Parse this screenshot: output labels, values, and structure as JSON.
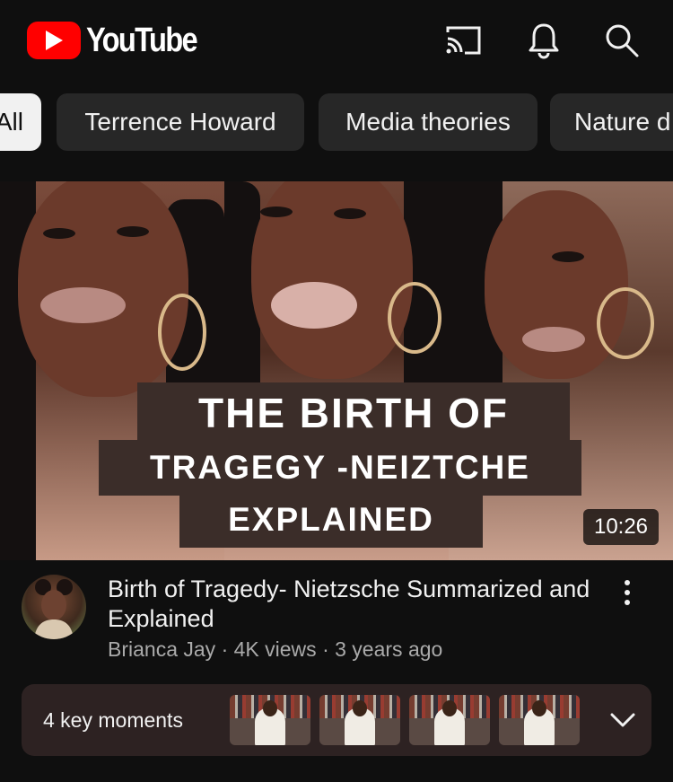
{
  "app": {
    "name": "YouTube",
    "logo_text": "YouTube",
    "brand_color": "#ff0000"
  },
  "header": {
    "icons": [
      "cast-icon",
      "bell-icon",
      "search-icon"
    ]
  },
  "chips": [
    {
      "label": "All",
      "selected": true
    },
    {
      "label": "Terrence Howard",
      "selected": false
    },
    {
      "label": "Media theories",
      "selected": false
    },
    {
      "label": "Nature d",
      "selected": false
    }
  ],
  "video": {
    "thumbnail_caption": {
      "line1": "THE BIRTH OF",
      "line2": "TRAGEGY -NEIZTCHE",
      "line3": "EXPLAINED"
    },
    "duration": "10:26",
    "title": "Birth of Tragedy- Nietzsche Summarized and Explained",
    "channel": "Brianca Jay",
    "views": "4K views",
    "age": "3 years ago",
    "key_moments_label": "4 key moments"
  }
}
